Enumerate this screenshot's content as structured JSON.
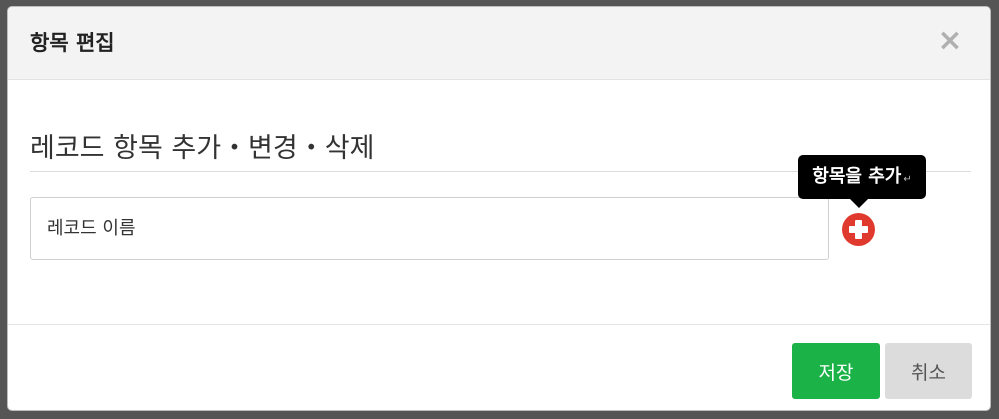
{
  "dialog": {
    "title": "항목 편집",
    "close_icon": "close-icon",
    "close_glyph": "×"
  },
  "section": {
    "heading": "레코드 항목 추가・변경・삭제"
  },
  "record_name": {
    "value": "",
    "placeholder": "레코드 이름"
  },
  "add_item": {
    "icon": "plus-circle-icon",
    "color": "#e03a2e",
    "tooltip": "항목을 추가",
    "tooltip_return_glyph": "↵"
  },
  "footer": {
    "save_label": "저장",
    "save_color": "#1bb347",
    "cancel_label": "취소"
  }
}
